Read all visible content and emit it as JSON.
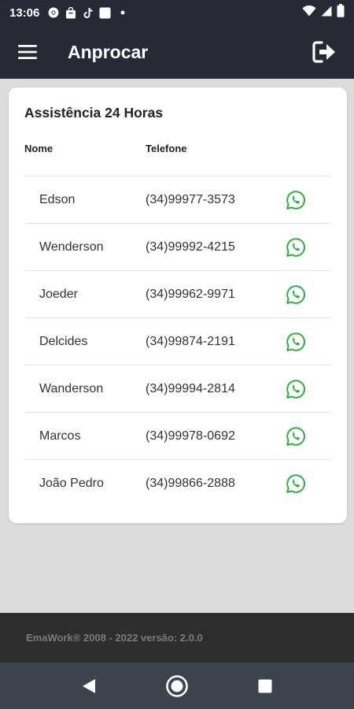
{
  "status_bar": {
    "time": "13:06"
  },
  "app_bar": {
    "title": "Anprocar"
  },
  "card": {
    "title": "Assistência 24 Horas",
    "columns": {
      "name": "Nome",
      "phone": "Telefone"
    },
    "contacts": [
      {
        "name": "Edson",
        "phone": "(34)99977-3573"
      },
      {
        "name": "Wenderson",
        "phone": "(34)99992-4215"
      },
      {
        "name": "Joeder",
        "phone": "(34)99962-9971"
      },
      {
        "name": "Delcides",
        "phone": "(34)99874-2191"
      },
      {
        "name": "Wanderson",
        "phone": "(34)99994-2814"
      },
      {
        "name": "Marcos",
        "phone": "(34)99978-0692"
      },
      {
        "name": "João Pedro",
        "phone": "(34)99866-2888"
      }
    ]
  },
  "footer": {
    "text": "EmaWork® 2008 - 2022 versão: 2.0.0"
  },
  "colors": {
    "app_bar": "#272a35",
    "whatsapp": "#2eae3d",
    "footer": "#2e2e2e",
    "nav_bar": "#3c434d"
  }
}
